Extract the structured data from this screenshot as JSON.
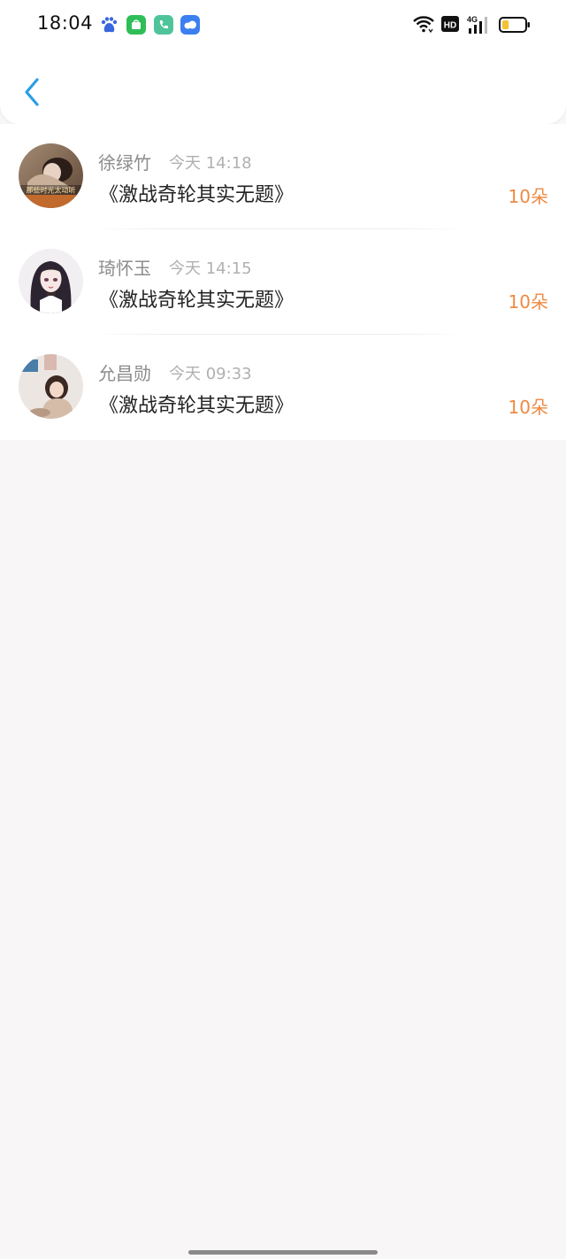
{
  "status_bar": {
    "time": "18:04",
    "app_icons": [
      "baidu-paw-icon",
      "app-market-icon",
      "phone-icon",
      "cloud-icon"
    ],
    "system_icons": [
      "wifi-icon",
      "hd-icon",
      "signal-4g-icon",
      "battery-icon"
    ],
    "network": "4G",
    "hd_label": "HD",
    "battery_level": 0.3
  },
  "nav": {
    "back_icon": "chevron-left-icon",
    "accent": "#2a9ee6"
  },
  "list": {
    "items": [
      {
        "user": "徐绿竹",
        "time": "今天 14:18",
        "title": "《激战奇轮其实无题》",
        "count": "10朵",
        "avatar_caption": "那些时光太动听"
      },
      {
        "user": "琦怀玉",
        "time": "今天 14:15",
        "title": "《激战奇轮其实无题》",
        "count": "10朵"
      },
      {
        "user": "允昌勋",
        "time": "今天 09:33",
        "title": "《激战奇轮其实无题》",
        "count": "10朵"
      }
    ]
  },
  "colors": {
    "count": "#ee8a42",
    "background": "#f8f6f7"
  }
}
